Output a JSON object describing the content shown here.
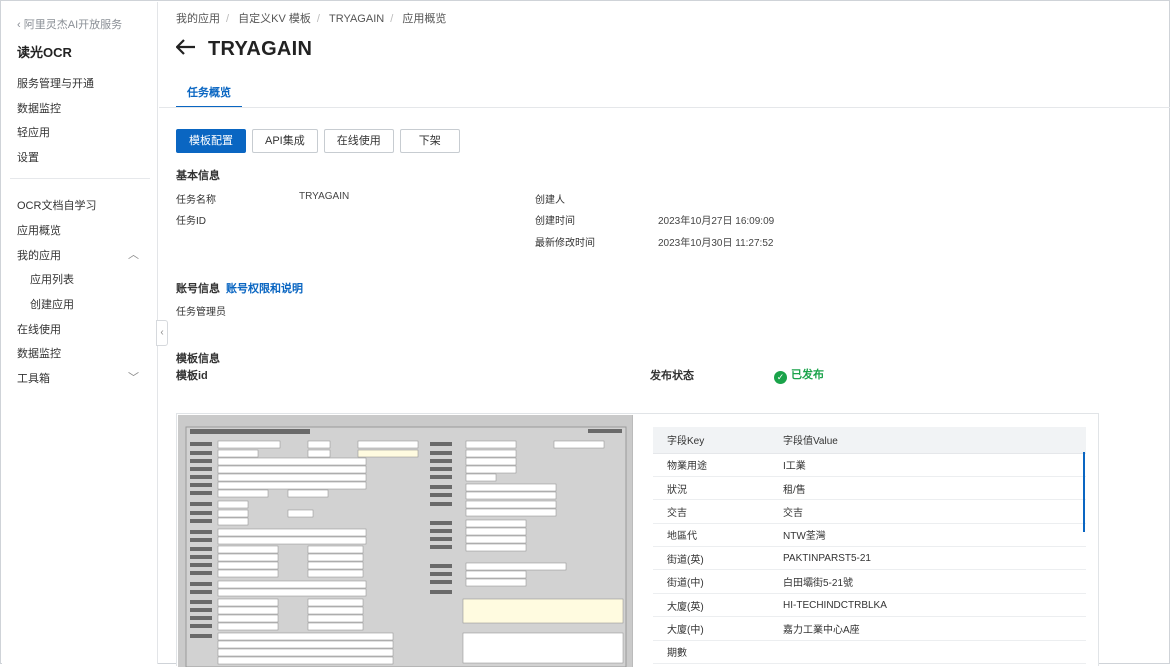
{
  "sidebar": {
    "back": "阿里灵杰AI开放服务",
    "title": "读光OCR",
    "group1": [
      "服务管理与开通",
      "数据监控",
      "轻应用",
      "设置"
    ],
    "group2": {
      "item1": "OCR文档自学习",
      "item2": "应用概览",
      "my_apps": "我的应用",
      "app_list": "应用列表",
      "create_app": "创建应用",
      "online_use": "在线使用",
      "data_monitor": "数据监控",
      "toolbox": "工具箱"
    }
  },
  "breadcrumb": [
    "我的应用",
    "自定义KV 模板",
    "TRYAGAIN",
    "应用概览"
  ],
  "page_title": "TRYAGAIN",
  "tab": "任务概览",
  "buttons": {
    "config": "模板配置",
    "api": "API集成",
    "online": "在线使用",
    "offline": "下架"
  },
  "basic": {
    "heading": "基本信息",
    "task_name_label": "任务名称",
    "task_name": "TRYAGAIN",
    "task_id_label": "任务ID",
    "creator_label": "创建人",
    "created_label": "创建时间",
    "created": "2023年10月27日 16:09:09",
    "modified_label": "最新修改时间",
    "modified": "2023年10月30日 11:27:52"
  },
  "account": {
    "heading": "账号信息",
    "link": "账号权限和说明",
    "admin_label": "任务管理员"
  },
  "template": {
    "heading": "模板信息",
    "id_label": "模板id",
    "status_label": "发布状态",
    "status": "已发布"
  },
  "fields_table": {
    "headers": [
      "字段Key",
      "字段值Value"
    ],
    "rows": [
      [
        "物業用途",
        "I工業"
      ],
      [
        "狀況",
        "租/售"
      ],
      [
        "交吉",
        "交吉"
      ],
      [
        "地區代",
        "NTW荃灣"
      ],
      [
        "街道(英)",
        "PAKTINPARST5-21"
      ],
      [
        "街道(中)",
        "白田壩街5-21號"
      ],
      [
        "大廈(英)",
        "HI-TECHINDCTRBLKA"
      ],
      [
        "大廈(中)",
        "嘉力工業中心A座"
      ],
      [
        "期數",
        ""
      ]
    ]
  },
  "colors": {
    "accent": "#0a66c2",
    "success": "#1aa34a"
  }
}
